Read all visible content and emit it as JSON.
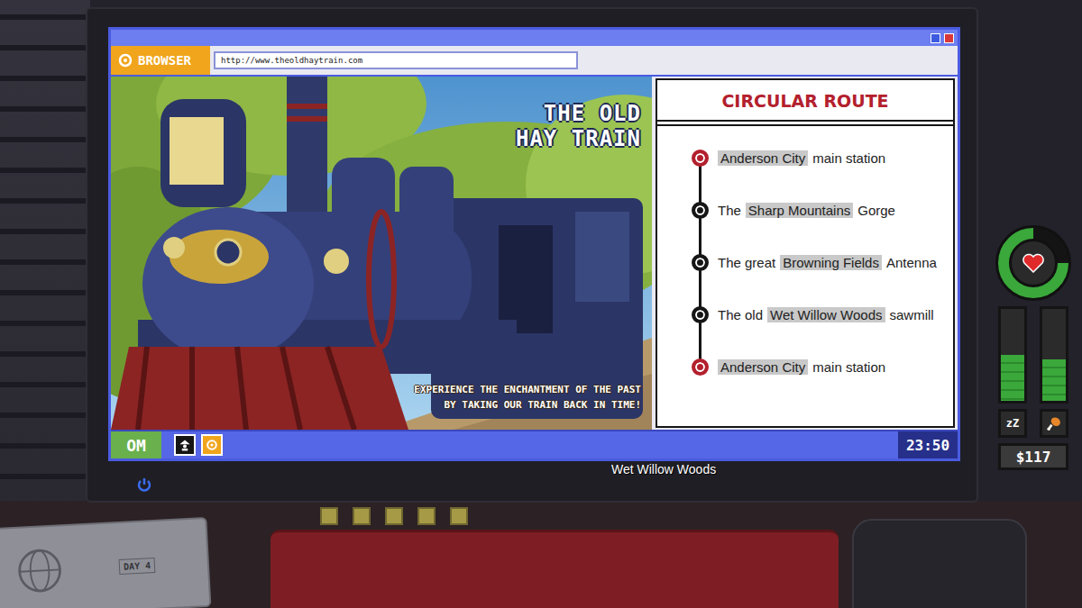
{
  "browser": {
    "badge": "BROWSER",
    "url": "http://www.theoldhaytrain.com",
    "controls": [
      {
        "name": "minimize",
        "color": "#3d5be0"
      },
      {
        "name": "close",
        "color": "#d8383a"
      }
    ]
  },
  "banner": {
    "title_lines": [
      "THE OLD",
      "HAY TRAIN"
    ],
    "tagline_lines": [
      "EXPERIENCE THE ENCHANTMENT OF THE PAST",
      "BY TAKING OUR TRAIN BACK IN TIME!"
    ]
  },
  "route": {
    "title": "CIRCULAR ROUTE",
    "stops": [
      {
        "prefix": "",
        "place": "Anderson City",
        "suffix": "main station",
        "terminal": true
      },
      {
        "prefix": "The",
        "place": "Sharp Mountains",
        "suffix": "Gorge",
        "terminal": false
      },
      {
        "prefix": "The great",
        "place": "Browning Fields",
        "suffix": "Antenna",
        "terminal": false
      },
      {
        "prefix": "The old",
        "place": "Wet Willow Woods",
        "suffix": "sawmill",
        "terminal": false
      },
      {
        "prefix": "",
        "place": "Anderson City",
        "suffix": "main station",
        "terminal": true
      }
    ]
  },
  "taskbar": {
    "start": "OM",
    "apps": [
      {
        "kind": "contacts"
      },
      {
        "kind": "browser"
      }
    ],
    "clock": "23:50"
  },
  "caption": "Wet Willow Woods",
  "hud": {
    "health": {
      "level": 0.75
    },
    "sleep": {
      "label": "zZ",
      "level": 0.5
    },
    "hunger": {
      "level": 0.45
    },
    "money": "$117"
  },
  "notebook": {
    "day": "DAY 4"
  }
}
